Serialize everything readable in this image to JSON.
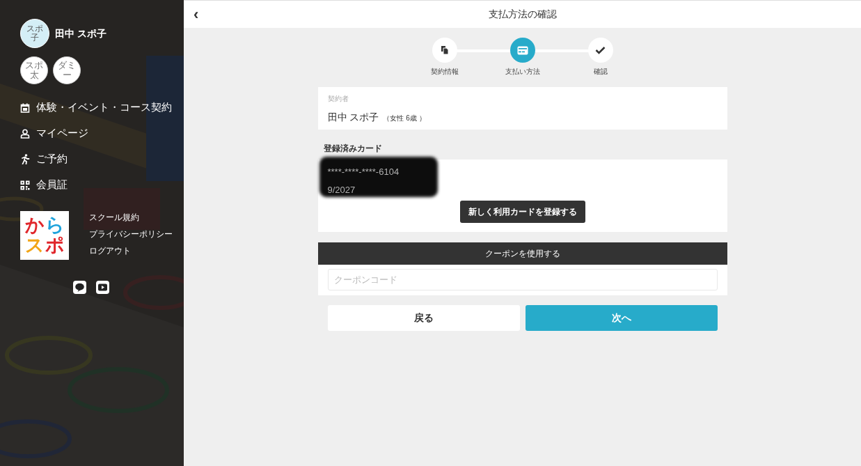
{
  "sidebar": {
    "user": {
      "avatar": "スポ子",
      "name": "田中 スポ子"
    },
    "family": [
      {
        "avatar": "スポ太"
      },
      {
        "avatar": "ダミー"
      }
    ],
    "menu": [
      {
        "label": "体験・イベント・コース契約"
      },
      {
        "label": "マイページ"
      },
      {
        "label": "ご予約"
      },
      {
        "label": "会員証"
      }
    ],
    "logo": [
      {
        "text": "か",
        "color": "#e0262b"
      },
      {
        "text": "ら",
        "color": "#1fa3dc"
      },
      {
        "text": "ス",
        "color": "#f2a516"
      },
      {
        "text": "ポ",
        "color": "#e0262b"
      }
    ],
    "links": [
      "スクール規約",
      "プライバシーポリシー",
      "ログアウト"
    ],
    "social": [
      {
        "kind": "line"
      },
      {
        "kind": "youtube"
      }
    ]
  },
  "header": {
    "back": "‹",
    "title": "支払方法の確認"
  },
  "steps": [
    {
      "label": "契約情報",
      "selected": false
    },
    {
      "label": "支払い方法",
      "selected": true
    },
    {
      "label": "確認",
      "selected": false
    }
  ],
  "contractor": {
    "label": "契約者",
    "name": "田中 スポ子",
    "detail": "（女性 6歳 ）"
  },
  "cards": {
    "heading": "登録済みカード",
    "number": "****-****-****-6104",
    "expiry": "9/2027",
    "register_button": "新しく利用カードを登録する"
  },
  "coupon": {
    "heading": "クーポンを使用する",
    "placeholder": "クーポンコード"
  },
  "buttons": {
    "back": "戻る",
    "next": "次へ"
  }
}
